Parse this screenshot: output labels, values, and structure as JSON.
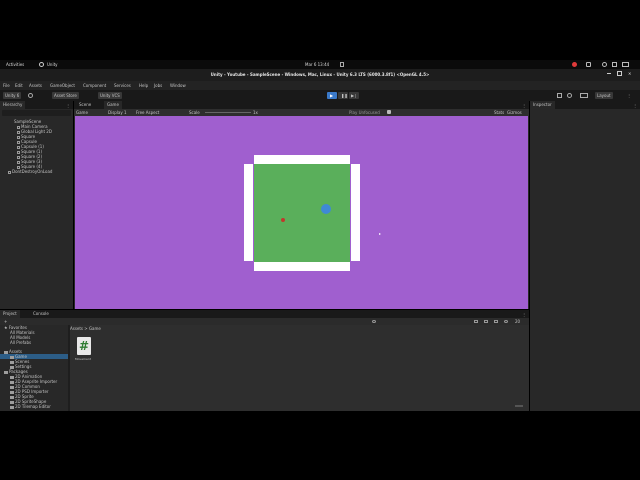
{
  "gnome": {
    "activities": "Activities",
    "app": "Unity",
    "clock": "Mar 6  13:44"
  },
  "window": {
    "title": "Unity - Youtube - SampleScene - Windows, Mac, Linux - Unity 6.3 LTS (6000.3.8f1) <OpenGL 4.5>"
  },
  "menu": [
    "File",
    "Edit",
    "Assets",
    "GameObject",
    "Component",
    "Services",
    "Help",
    "Jobs",
    "Window"
  ],
  "toolbar": {
    "account": "Unity 6",
    "cloud": "Asset Store",
    "uvcs": "Unity VCS",
    "layout": "Layout"
  },
  "hierarchy": {
    "tab": "Hierarchy",
    "items": [
      {
        "label": "SampleScene",
        "level": 0
      },
      {
        "label": "Main Camera",
        "level": 1
      },
      {
        "label": "Global Light 2D",
        "level": 1
      },
      {
        "label": "Square",
        "level": 1
      },
      {
        "label": "Capsule",
        "level": 1
      },
      {
        "label": "Capsule (1)",
        "level": 1
      },
      {
        "label": "Square (1)",
        "level": 1
      },
      {
        "label": "Square (2)",
        "level": 1
      },
      {
        "label": "Square (3)",
        "level": 1
      },
      {
        "label": "Square (4)",
        "level": 1
      },
      {
        "label": "DontDestroyOnLoad",
        "level": 0
      }
    ]
  },
  "scene_tabs": [
    "Scene",
    "Game"
  ],
  "game_bar": {
    "mode": "Game",
    "display": "Display 1",
    "aspect": "Free Aspect",
    "scale_label": "Scale",
    "scale_value": "1x",
    "play_focused": "Play Unfocused",
    "stats": "Stats",
    "gizmos": "Gizmos"
  },
  "inspector": {
    "tab": "Inspector"
  },
  "project": {
    "tabs": [
      "Project",
      "Console"
    ],
    "favorites_label": "Favorites",
    "favorites": [
      "All Materials",
      "All Models",
      "All Prefabs"
    ],
    "assets_label": "Assets",
    "assets": [
      "Game",
      "Scenes",
      "Settings"
    ],
    "packages_label": "Packages",
    "packages": [
      "2D Animation",
      "2D Aseprite Importer",
      "2D Common",
      "2D PSD Importer",
      "2D Sprite",
      "2D SpriteShape",
      "2D Tilemap Editor"
    ],
    "breadcrumb": [
      "Assets",
      "Game"
    ],
    "file": {
      "name": "Movement",
      "glyph": "#"
    },
    "count": "20"
  },
  "colors": {
    "game_bg": "#a05fcf",
    "field_green": "#5aaf5b",
    "wall_white": "#ffffff",
    "ball_blue": "#3f89d6",
    "ball_orange": "#c0392b",
    "rec_red": "#e03a3a"
  }
}
